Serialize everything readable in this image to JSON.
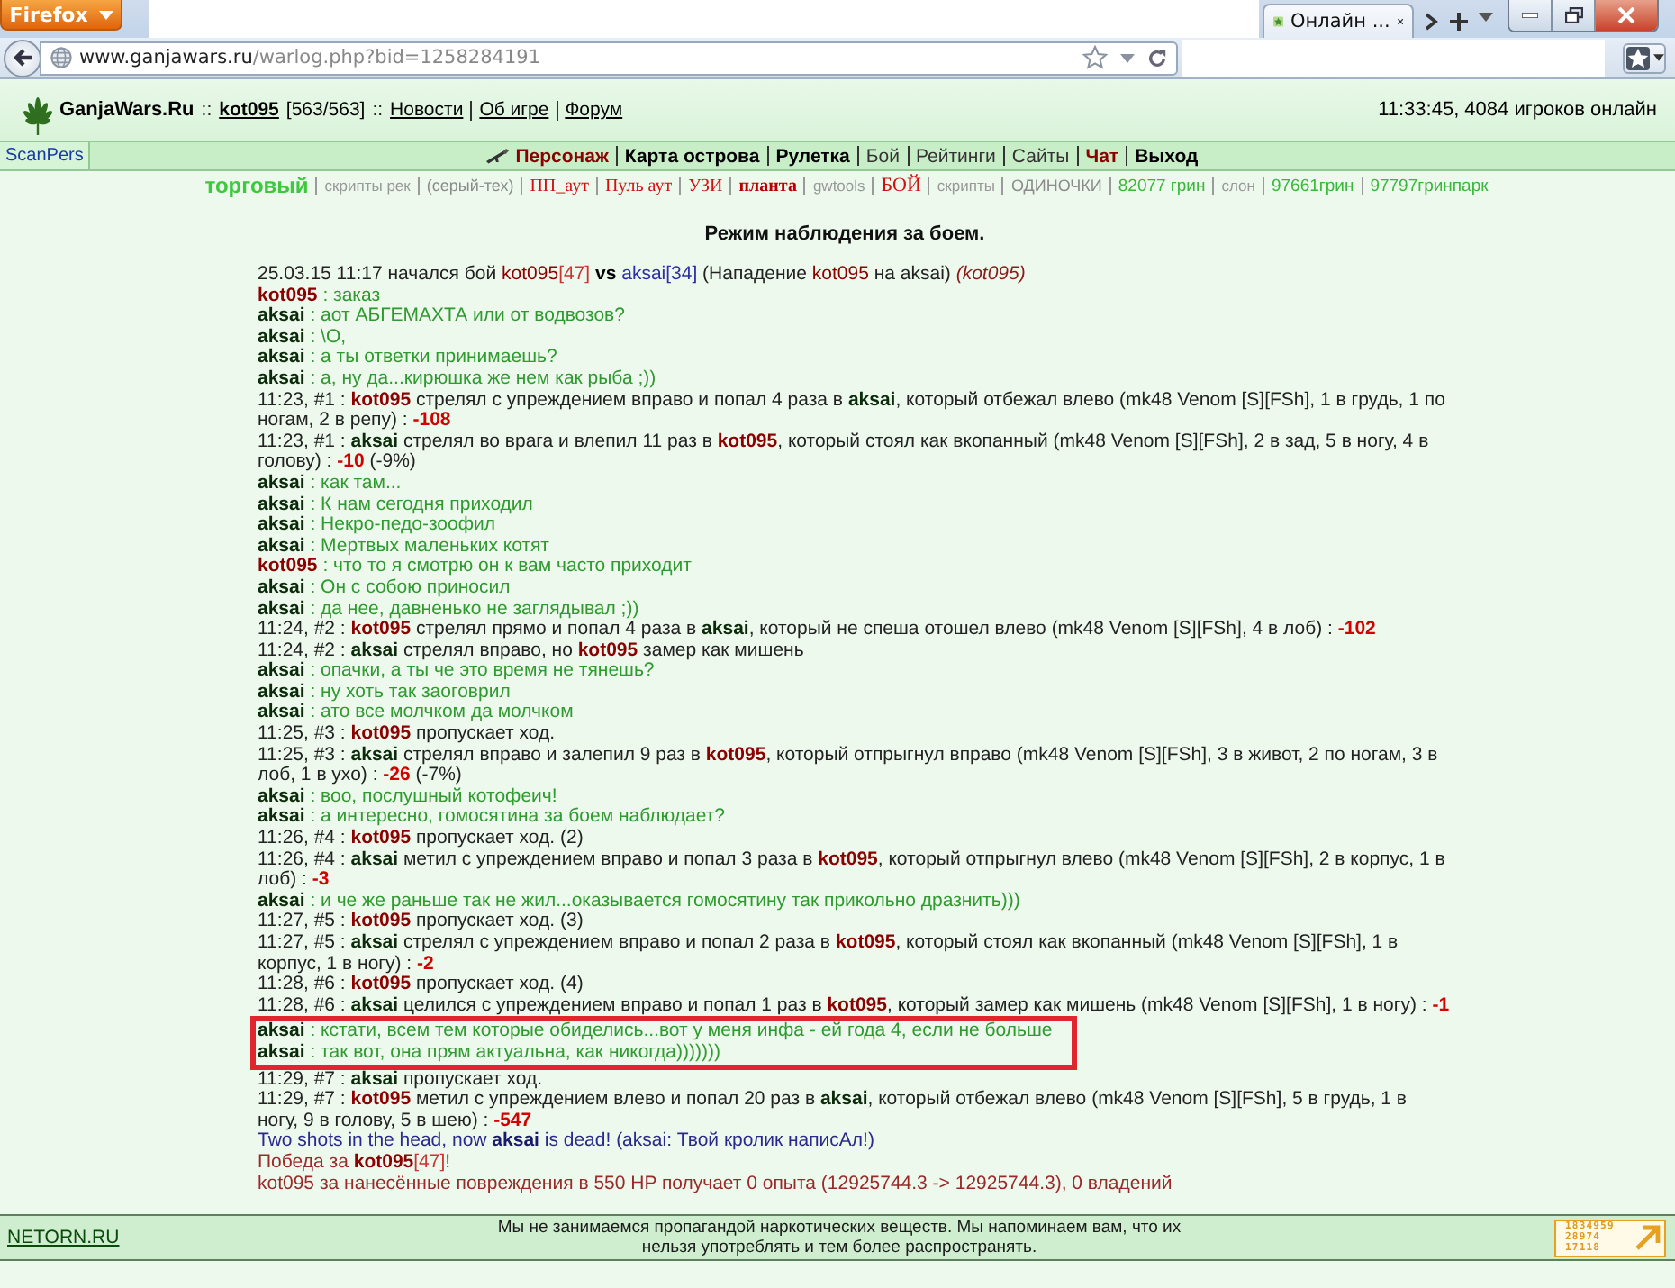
{
  "browser": {
    "menu_button": "Firefox",
    "tab": {
      "title": "Онлайн ..."
    },
    "url_host": "www.ganjawars.ru",
    "url_path": "/warlog.php?bid=1258284191"
  },
  "header": {
    "parts": [
      {
        "kind": "brand",
        "text": "GanjaWars.Ru"
      },
      {
        "kind": "sep",
        "text": "::"
      },
      {
        "kind": "user",
        "text": "kot095"
      },
      {
        "kind": "plain",
        "text": "[563/563]"
      },
      {
        "kind": "sep",
        "text": "::"
      }
    ],
    "links": [
      "Новости",
      "Об игре",
      "Форум"
    ],
    "status": "11:33:45, 4084 игроков онлайн"
  },
  "nav": {
    "scan_link": "ScanPers",
    "menu": [
      {
        "label": "Персонаж",
        "kind": "armed"
      },
      {
        "label": "Карта острова",
        "kind": "bold"
      },
      {
        "label": "Рулетка",
        "kind": "bold"
      },
      {
        "label": "Бой",
        "kind": "plain"
      },
      {
        "label": "Рейтинги",
        "kind": "plain"
      },
      {
        "label": "Сайты",
        "kind": "plain"
      },
      {
        "label": "Чат",
        "kind": "accent"
      },
      {
        "label": "Выход",
        "kind": "bold"
      }
    ]
  },
  "quick_links": [
    {
      "label": "торговый",
      "kind": "trade"
    },
    {
      "label": "скрипты рек",
      "kind": "minor"
    },
    {
      "label": "(серый-тех)",
      "kind": "gray"
    },
    {
      "label": "ПП_аут",
      "kind": "red"
    },
    {
      "label": "Пуль аут",
      "kind": "red"
    },
    {
      "label": "УЗИ",
      "kind": "red"
    },
    {
      "label": "планта",
      "kind": "crimson"
    },
    {
      "label": "gwtools",
      "kind": "minor"
    },
    {
      "label": "БОЙ",
      "kind": "bigred"
    },
    {
      "label": "скрипты",
      "kind": "minor"
    },
    {
      "label": "ОДИНОЧКИ",
      "kind": "gray"
    },
    {
      "label": "82077 грин",
      "kind": "green"
    },
    {
      "label": "слон",
      "kind": "minor"
    },
    {
      "label": "97661грин",
      "kind": "green"
    },
    {
      "label": "97797гринпарк",
      "kind": "green"
    }
  ],
  "title": "Режим наблюдения за боем.",
  "log": [
    {
      "highlighted": false,
      "parts": [
        {
          "kind": "plain",
          "text": "25.03.15 11:17 начался бой "
        },
        {
          "kind": "red",
          "text": "kot095"
        },
        {
          "kind": "redlight",
          "text": "[47]"
        },
        {
          "kind": "bold",
          "text": " vs "
        },
        {
          "kind": "blue",
          "text": "aksai[34]"
        },
        {
          "kind": "plain",
          "text": " (Нападение "
        },
        {
          "kind": "red",
          "text": "kot095"
        },
        {
          "kind": "plain",
          "text": " на aksai) "
        },
        {
          "kind": "italic",
          "text": "(kot095)"
        }
      ]
    },
    {
      "highlighted": false,
      "parts": [
        {
          "kind": "redbold",
          "text": "kot095"
        },
        {
          "kind": "chat",
          "text": " : заказ"
        }
      ]
    },
    {
      "highlighted": false,
      "parts": [
        {
          "kind": "darkbold",
          "text": "aksai"
        },
        {
          "kind": "chat",
          "text": " : аот АБГЕМАХТА или от водвозов?"
        }
      ]
    },
    {
      "highlighted": false,
      "parts": [
        {
          "kind": "darkbold",
          "text": "aksai"
        },
        {
          "kind": "chat",
          "text": " : \\O,"
        }
      ]
    },
    {
      "highlighted": false,
      "parts": [
        {
          "kind": "darkbold",
          "text": "aksai"
        },
        {
          "kind": "chat",
          "text": " : а ты ответки принимаешь?"
        }
      ]
    },
    {
      "highlighted": false,
      "parts": [
        {
          "kind": "darkbold",
          "text": "aksai"
        },
        {
          "kind": "chat",
          "text": " : а, ну да...кирюшка же нем как рыба ;))"
        }
      ]
    },
    {
      "highlighted": false,
      "parts": [
        {
          "kind": "plain",
          "text": "11:23, #1 : "
        },
        {
          "kind": "redbold",
          "text": "kot095"
        },
        {
          "kind": "plain",
          "text": " стрелял с упреждением вправо и попал 4 раза в "
        },
        {
          "kind": "darkbold",
          "text": "aksai"
        },
        {
          "kind": "plain",
          "text": ", который отбежал влево (mk48 Venom [S][FSh], 1 в грудь, 1 по ногам, 2 в репу) : "
        },
        {
          "kind": "damage",
          "text": "-108"
        }
      ]
    },
    {
      "highlighted": false,
      "parts": [
        {
          "kind": "plain",
          "text": "11:23, #1 : "
        },
        {
          "kind": "darkbold",
          "text": "aksai"
        },
        {
          "kind": "plain",
          "text": " стрелял во врага и влепил 11 раз в "
        },
        {
          "kind": "redbold",
          "text": "kot095"
        },
        {
          "kind": "plain",
          "text": ", который стоял как вкопанный (mk48 Venom [S][FSh], 2 в зад, 5 в ногу, 4 в голову) : "
        },
        {
          "kind": "damage",
          "text": "-10"
        },
        {
          "kind": "plain",
          "text": " (-9%)"
        }
      ]
    },
    {
      "highlighted": false,
      "parts": [
        {
          "kind": "darkbold",
          "text": "aksai"
        },
        {
          "kind": "chat",
          "text": " : как там..."
        }
      ]
    },
    {
      "highlighted": false,
      "parts": [
        {
          "kind": "darkbold",
          "text": "aksai"
        },
        {
          "kind": "chat",
          "text": " : К нам сегодня приходил"
        }
      ]
    },
    {
      "highlighted": false,
      "parts": [
        {
          "kind": "darkbold",
          "text": "aksai"
        },
        {
          "kind": "chat",
          "text": " : Некро-педо-зоофил"
        }
      ]
    },
    {
      "highlighted": false,
      "parts": [
        {
          "kind": "darkbold",
          "text": "aksai"
        },
        {
          "kind": "chat",
          "text": " : Мертвых маленьких котят"
        }
      ]
    },
    {
      "highlighted": false,
      "parts": [
        {
          "kind": "redbold",
          "text": "kot095"
        },
        {
          "kind": "chat",
          "text": " : что то я смотрю он к вам часто приходит"
        }
      ]
    },
    {
      "highlighted": false,
      "parts": [
        {
          "kind": "darkbold",
          "text": "aksai"
        },
        {
          "kind": "chat",
          "text": " : Он с собою приносил"
        }
      ]
    },
    {
      "highlighted": false,
      "parts": [
        {
          "kind": "darkbold",
          "text": "aksai"
        },
        {
          "kind": "chat",
          "text": " : да нее, давненько не заглядывал ;))"
        }
      ]
    },
    {
      "highlighted": false,
      "parts": [
        {
          "kind": "plain",
          "text": "11:24, #2 : "
        },
        {
          "kind": "redbold",
          "text": "kot095"
        },
        {
          "kind": "plain",
          "text": " стрелял прямо и попал 4 раза в "
        },
        {
          "kind": "darkbold",
          "text": "aksai"
        },
        {
          "kind": "plain",
          "text": ", который не спеша отошел влево (mk48 Venom [S][FSh], 4 в лоб) : "
        },
        {
          "kind": "damage",
          "text": "-102"
        }
      ]
    },
    {
      "highlighted": false,
      "parts": [
        {
          "kind": "plain",
          "text": "11:24, #2 : "
        },
        {
          "kind": "darkbold",
          "text": "aksai"
        },
        {
          "kind": "plain",
          "text": " стрелял вправо, но "
        },
        {
          "kind": "redbold",
          "text": "kot095"
        },
        {
          "kind": "plain",
          "text": " замер как мишень"
        }
      ]
    },
    {
      "highlighted": false,
      "parts": [
        {
          "kind": "darkbold",
          "text": "aksai"
        },
        {
          "kind": "chat",
          "text": " : опачки, а ты че это время не тянешь?"
        }
      ]
    },
    {
      "highlighted": false,
      "parts": [
        {
          "kind": "darkbold",
          "text": "aksai"
        },
        {
          "kind": "chat",
          "text": " : ну хоть так заоговрил"
        }
      ]
    },
    {
      "highlighted": false,
      "parts": [
        {
          "kind": "darkbold",
          "text": "aksai"
        },
        {
          "kind": "chat",
          "text": " : ато все молчком да молчком"
        }
      ]
    },
    {
      "highlighted": false,
      "parts": [
        {
          "kind": "plain",
          "text": "11:25, #3 : "
        },
        {
          "kind": "redbold",
          "text": "kot095"
        },
        {
          "kind": "plain",
          "text": " пропускает ход."
        }
      ]
    },
    {
      "highlighted": false,
      "parts": [
        {
          "kind": "plain",
          "text": "11:25, #3 : "
        },
        {
          "kind": "darkbold",
          "text": "aksai"
        },
        {
          "kind": "plain",
          "text": " стрелял вправо и залепил 9 раз в "
        },
        {
          "kind": "redbold",
          "text": "kot095"
        },
        {
          "kind": "plain",
          "text": ", который отпрыгнул вправо (mk48 Venom [S][FSh], 3 в живот, 2 по ногам, 3 в лоб, 1 в ухо) : "
        },
        {
          "kind": "damage",
          "text": "-26"
        },
        {
          "kind": "plain",
          "text": " (-7%)"
        }
      ]
    },
    {
      "highlighted": false,
      "parts": [
        {
          "kind": "darkbold",
          "text": "aksai"
        },
        {
          "kind": "chat",
          "text": " : воо, послушный котофеич!"
        }
      ]
    },
    {
      "highlighted": false,
      "parts": [
        {
          "kind": "darkbold",
          "text": "aksai"
        },
        {
          "kind": "chat",
          "text": " : а интересно, гомосятина за боем наблюдает?"
        }
      ]
    },
    {
      "highlighted": false,
      "parts": [
        {
          "kind": "plain",
          "text": "11:26, #4 : "
        },
        {
          "kind": "redbold",
          "text": "kot095"
        },
        {
          "kind": "plain",
          "text": " пропускает ход. (2)"
        }
      ]
    },
    {
      "highlighted": false,
      "parts": [
        {
          "kind": "plain",
          "text": "11:26, #4 : "
        },
        {
          "kind": "darkbold",
          "text": "aksai"
        },
        {
          "kind": "plain",
          "text": " метил с упреждением вправо и попал 3 раза в "
        },
        {
          "kind": "redbold",
          "text": "kot095"
        },
        {
          "kind": "plain",
          "text": ", который отпрыгнул влево (mk48 Venom [S][FSh], 2 в корпус, 1 в лоб) : "
        },
        {
          "kind": "damage",
          "text": "-3"
        }
      ]
    },
    {
      "highlighted": false,
      "parts": [
        {
          "kind": "darkbold",
          "text": "aksai"
        },
        {
          "kind": "chat",
          "text": " : и че же раньше так не жил...оказывается гомосятину так прикольно дразнить)))"
        }
      ]
    },
    {
      "highlighted": false,
      "parts": [
        {
          "kind": "plain",
          "text": "11:27, #5 : "
        },
        {
          "kind": "redbold",
          "text": "kot095"
        },
        {
          "kind": "plain",
          "text": " пропускает ход. (3)"
        }
      ]
    },
    {
      "highlighted": false,
      "parts": [
        {
          "kind": "plain",
          "text": "11:27, #5 : "
        },
        {
          "kind": "darkbold",
          "text": "aksai"
        },
        {
          "kind": "plain",
          "text": " стрелял с упреждением вправо и попал 2 раза в "
        },
        {
          "kind": "redbold",
          "text": "kot095"
        },
        {
          "kind": "plain",
          "text": ", который стоял как вкопанный (mk48 Venom [S][FSh], 1 в корпус, 1 в ногу) : "
        },
        {
          "kind": "damage",
          "text": "-2"
        }
      ]
    },
    {
      "highlighted": false,
      "parts": [
        {
          "kind": "plain",
          "text": "11:28, #6 : "
        },
        {
          "kind": "redbold",
          "text": "kot095"
        },
        {
          "kind": "plain",
          "text": " пропускает ход. (4)"
        }
      ]
    },
    {
      "highlighted": false,
      "parts": [
        {
          "kind": "plain",
          "text": "11:28, #6 : "
        },
        {
          "kind": "darkbold",
          "text": "aksai"
        },
        {
          "kind": "plain",
          "text": " целился с упреждением вправо и попал 1 раз в "
        },
        {
          "kind": "redbold",
          "text": "kot095"
        },
        {
          "kind": "plain",
          "text": ", который замер как мишень (mk48 Venom [S][FSh], 1 в ногу) : "
        },
        {
          "kind": "damage",
          "text": "-1"
        }
      ]
    },
    {
      "highlighted": true,
      "parts": [
        {
          "kind": "darkbold",
          "text": "aksai"
        },
        {
          "kind": "chat",
          "text": " : кстати, всем тем которые обиделись...вот у меня инфа - ей года 4, если не больше"
        }
      ]
    },
    {
      "highlighted": true,
      "parts": [
        {
          "kind": "darkbold",
          "text": "aksai"
        },
        {
          "kind": "chat",
          "text": " : так вот, она прям актуальна, как никогда)))))))"
        }
      ]
    },
    {
      "highlighted": false,
      "parts": [
        {
          "kind": "plain",
          "text": "11:29, #7 : "
        },
        {
          "kind": "darkbold",
          "text": "aksai"
        },
        {
          "kind": "plain",
          "text": " пропускает ход."
        }
      ]
    },
    {
      "highlighted": false,
      "parts": [
        {
          "kind": "plain",
          "text": "11:29, #7 : "
        },
        {
          "kind": "redbold",
          "text": "kot095"
        },
        {
          "kind": "plain",
          "text": " метил с упреждением влево и попал 20 раз в "
        },
        {
          "kind": "darkbold",
          "text": "aksai"
        },
        {
          "kind": "plain",
          "text": ", который отбежал влево (mk48 Venom [S][FSh], 5 в грудь, 1 в ногу, 9 в голову, 5 в шею) : "
        },
        {
          "kind": "damage",
          "text": "-547"
        }
      ]
    },
    {
      "highlighted": false,
      "parts": [
        {
          "kind": "navy",
          "text": "Two shots in the head, now "
        },
        {
          "kind": "navybold",
          "text": "aksai"
        },
        {
          "kind": "navy",
          "text": " is dead! (aksai: Твой кролик написАл!)"
        }
      ]
    },
    {
      "highlighted": false,
      "parts": [
        {
          "kind": "maroon",
          "text": "Победа за "
        },
        {
          "kind": "redbold",
          "text": "kot095"
        },
        {
          "kind": "redlight",
          "text": "[47]"
        },
        {
          "kind": "maroon",
          "text": "!"
        }
      ]
    },
    {
      "highlighted": false,
      "parts": [
        {
          "kind": "maroon",
          "text": "kot095 за нанесённые повреждения в 550 HP получает 0 опыта (12925744.3 -> 12925744.3), 0 владений"
        }
      ]
    }
  ],
  "footer": {
    "link": "NETORN.RU",
    "notice": "Мы не занимаемся пропагандой наркотических веществ. Мы напоминаем вам, что их нельзя употреблять и тем более распространять.",
    "counter": [
      "1834959",
      "28974",
      "17118"
    ]
  }
}
